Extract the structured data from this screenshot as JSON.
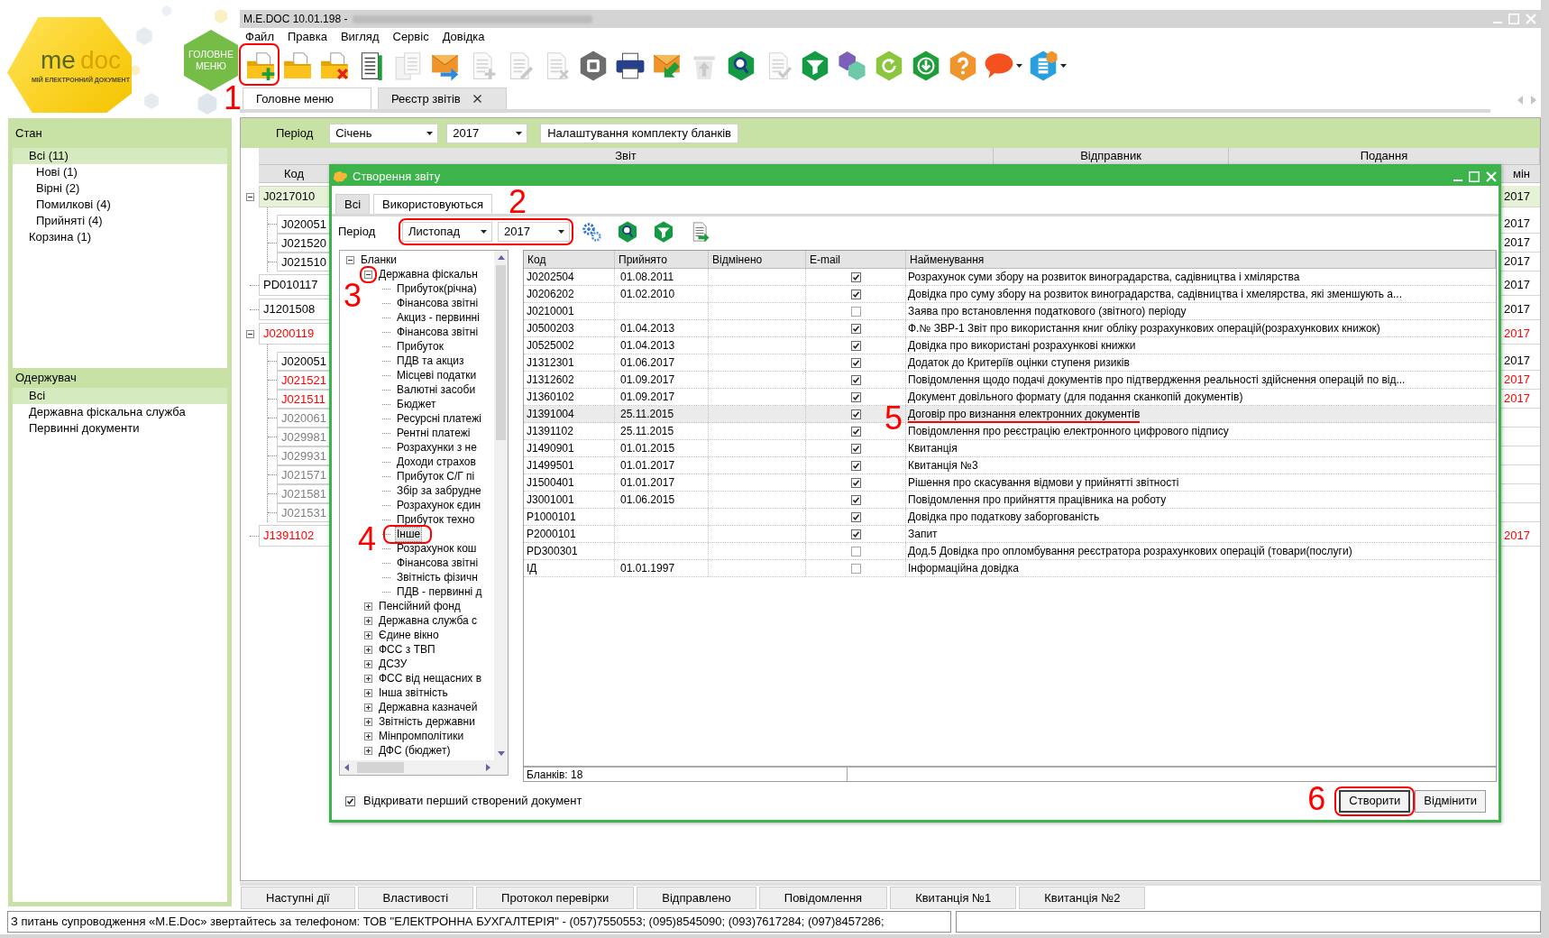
{
  "logo": {
    "brand_left": "me",
    "brand_right": "doc",
    "tagline": "МІЙ ЕЛЕКТРОННИЙ ДОКУМЕНТ"
  },
  "home_button": {
    "label": "ГОЛОВНЕ МЕНЮ"
  },
  "window": {
    "title": "M.E.DOC 10.01.198 -"
  },
  "menu": [
    "Файл",
    "Правка",
    "Вигляд",
    "Сервіс",
    "Довідка"
  ],
  "toolbar": [
    {
      "kind": "new-folder",
      "disabled": false,
      "annotation": "1"
    },
    {
      "kind": "open-folder",
      "disabled": false
    },
    {
      "kind": "delete-folder",
      "disabled": false
    },
    {
      "kind": "document-list",
      "disabled": false
    },
    {
      "kind": "copy-document",
      "disabled": true
    },
    {
      "kind": "send-envelope",
      "disabled": false
    },
    {
      "kind": "add-document",
      "disabled": true
    },
    {
      "kind": "edit-document",
      "disabled": true
    },
    {
      "kind": "remove-document",
      "disabled": true
    },
    {
      "kind": "archive",
      "disabled": false
    },
    {
      "kind": "printer",
      "disabled": false
    },
    {
      "kind": "receive-envelope",
      "disabled": false
    },
    {
      "kind": "upload-bin",
      "disabled": true
    },
    {
      "kind": "search",
      "disabled": false
    },
    {
      "kind": "check-document",
      "disabled": true
    },
    {
      "kind": "filter",
      "disabled": false
    },
    {
      "kind": "hexagons",
      "disabled": false
    },
    {
      "kind": "refresh",
      "disabled": false
    },
    {
      "kind": "download",
      "disabled": false
    },
    {
      "kind": "help",
      "disabled": false
    },
    {
      "kind": "chat",
      "disabled": false,
      "menu": true
    },
    {
      "kind": "video-help",
      "disabled": false,
      "menu": true
    }
  ],
  "tabs": [
    {
      "label": "Головне меню",
      "selected": false,
      "closable": false
    },
    {
      "label": "Реєстр звітів",
      "selected": true,
      "closable": true
    }
  ],
  "status_panel": {
    "title": "Стан",
    "items": [
      {
        "label": "Всі (11)",
        "selected": true,
        "children": [
          {
            "label": "Нові (1)",
            "selected": false
          },
          {
            "label": "Вірні (2)",
            "selected": false
          },
          {
            "label": "Помилкові (4)",
            "selected": false
          },
          {
            "label": "Прийняті (4)",
            "selected": false
          }
        ]
      },
      {
        "label": "Корзина (1)",
        "selected": false
      }
    ]
  },
  "recipient_panel": {
    "title": "Одержувач",
    "items": [
      {
        "label": "Всі",
        "selected": true
      },
      {
        "label": "Державна фіскальна служба",
        "selected": false
      },
      {
        "label": "Первинні документи",
        "selected": false
      }
    ]
  },
  "filter_bar": {
    "period_label": "Період",
    "month": "Січень",
    "year": "2017",
    "settings_button": "Налаштування комплекту бланків"
  },
  "register": {
    "group_headers": [
      "Звіт",
      "Відправник",
      "Подання"
    ],
    "columns": [
      "Код",
      "мін"
    ],
    "rows": [
      {
        "code": "J0217010",
        "color": "#000000",
        "selected": true,
        "expanded": true,
        "year": "2017",
        "children": [
          {
            "code": "J020051",
            "color": "#000000",
            "selected": false,
            "year": "2017"
          },
          {
            "code": "J021520",
            "color": "#000000",
            "selected": false,
            "year": "2017"
          },
          {
            "code": "J021510",
            "color": "#000000",
            "selected": false,
            "year": "2017"
          }
        ]
      },
      {
        "code": "PD010117",
        "color": "#000000",
        "selected": false,
        "year": "2017"
      },
      {
        "code": "J1201508",
        "color": "#000000",
        "selected": false,
        "year": "2017"
      },
      {
        "code": "J0200119",
        "color": "#ff0000",
        "selected": false,
        "expanded": true,
        "year": "2017",
        "children": [
          {
            "code": "J020051",
            "color": "#000000",
            "selected": false,
            "year": "2017"
          },
          {
            "code": "J021521",
            "color": "#ff0000",
            "selected": false,
            "year": "2017"
          },
          {
            "code": "J021511",
            "color": "#ff0000",
            "selected": false,
            "year": "2017"
          },
          {
            "code": "J020061",
            "color": "#808080",
            "selected": false
          },
          {
            "code": "J029981",
            "color": "#808080",
            "selected": false
          },
          {
            "code": "J029931",
            "color": "#808080",
            "selected": false
          },
          {
            "code": "J021571",
            "color": "#808080",
            "selected": false
          },
          {
            "code": "J021581",
            "color": "#808080",
            "selected": false
          },
          {
            "code": "J021531",
            "color": "#808080",
            "selected": false
          }
        ]
      },
      {
        "code": "J1391102",
        "color": "#ff0000",
        "selected": false,
        "year": "2017"
      }
    ]
  },
  "dialog": {
    "title": "Створення звіту",
    "tabs": [
      {
        "label": "Всі",
        "selected": true
      },
      {
        "label": "Використовуються",
        "selected": false
      }
    ],
    "period_label": "Період",
    "month": "Листопад",
    "year": "2017",
    "period_annotation": "2",
    "toolbar": [
      {
        "kind": "settings"
      },
      {
        "kind": "search"
      },
      {
        "kind": "filter"
      },
      {
        "kind": "export-document"
      }
    ],
    "tree": [
      {
        "label": "Бланки",
        "expanded": true,
        "selected": false,
        "children": [
          {
            "label": "Державна фіскальн",
            "expanded": true,
            "selected": false,
            "annotation": "3",
            "children": [
              {
                "label": "Прибуток(річна)",
                "selected": false
              },
              {
                "label": "Фінансова звітні",
                "selected": false
              },
              {
                "label": "Акциз - первинні",
                "selected": false
              },
              {
                "label": "Фінансова звітні",
                "selected": false
              },
              {
                "label": "Прибуток",
                "selected": false
              },
              {
                "label": "ПДВ та акциз",
                "selected": false
              },
              {
                "label": "Місцеві податки",
                "selected": false
              },
              {
                "label": "Валютні засоби",
                "selected": false
              },
              {
                "label": "Бюджет",
                "selected": false
              },
              {
                "label": "Ресурсні платежі",
                "selected": false
              },
              {
                "label": "Рентні платежі",
                "selected": false
              },
              {
                "label": "Розрахунки з не",
                "selected": false
              },
              {
                "label": "Доходи страхов",
                "selected": false
              },
              {
                "label": "Прибуток С/Г пі",
                "selected": false
              },
              {
                "label": "Збір за забрудне",
                "selected": false
              },
              {
                "label": "Розрахунок єдин",
                "selected": false
              },
              {
                "label": "Прибуток техно",
                "selected": false
              },
              {
                "label": "Інше",
                "selected": true,
                "annotation": "4"
              },
              {
                "label": "Розрахунок кош",
                "selected": false
              },
              {
                "label": "Фінансова звітні",
                "selected": false
              },
              {
                "label": "Звітність фізичн",
                "selected": false
              },
              {
                "label": "ПДВ - первинні д",
                "selected": false
              }
            ]
          },
          {
            "label": "Пенсійний фонд",
            "expanded": false,
            "selected": false
          },
          {
            "label": "Державна служба с",
            "expanded": false,
            "selected": false
          },
          {
            "label": "Єдине вікно",
            "expanded": false,
            "selected": false
          },
          {
            "label": "ФСС з ТВП",
            "expanded": false,
            "selected": false
          },
          {
            "label": "ДСЗУ",
            "expanded": false,
            "selected": false
          },
          {
            "label": "ФСС від нещасних в",
            "expanded": false,
            "selected": false
          },
          {
            "label": "Інша звітність",
            "expanded": false,
            "selected": false
          },
          {
            "label": "Державна казначей",
            "expanded": false,
            "selected": false
          },
          {
            "label": "Звітність державни",
            "expanded": false,
            "selected": false
          },
          {
            "label": "Мінпромполітики",
            "expanded": false,
            "selected": false
          },
          {
            "label": "ДФС (бюджет)",
            "expanded": false,
            "selected": false
          }
        ]
      }
    ],
    "table": {
      "columns": [
        "Код",
        "Прийнято",
        "Відмінено",
        "E-mail",
        "Найменування"
      ],
      "rows": [
        {
          "code": "J0202504",
          "accepted": "01.08.2011",
          "email": true,
          "selected": false,
          "name": "Розрахунок суми збору на розвиток виноградарства, садівництва і хмілярства"
        },
        {
          "code": "J0206202",
          "accepted": "01.02.2010",
          "email": true,
          "selected": false,
          "name": "Довідка про суму збору на розвиток виноградарства, садівництва і хмелярства, які зменшують а..."
        },
        {
          "code": "J0210001",
          "email": false,
          "selected": false,
          "name": "Заява про встановлення податкового (звітного) періоду"
        },
        {
          "code": "J0500203",
          "accepted": "01.04.2013",
          "email": true,
          "selected": false,
          "name": "Ф.№ ЗВР-1 Звіт про використання книг обліку розрахункових операцій(розрахункових книжок)"
        },
        {
          "code": "J0525002",
          "accepted": "01.04.2013",
          "email": true,
          "selected": false,
          "name": "Довідка про використані розрахункові книжки"
        },
        {
          "code": "J1312301",
          "accepted": "01.06.2017",
          "email": true,
          "selected": false,
          "name": "Додаток до Критеріїв оцінки ступеня ризиків"
        },
        {
          "code": "J1312602",
          "accepted": "01.09.2017",
          "email": true,
          "selected": false,
          "name": "Повідомлення щодо подачі документів про підтвердження реальності здійснення операцій по від..."
        },
        {
          "code": "J1360102",
          "accepted": "01.09.2017",
          "email": true,
          "selected": false,
          "name": "Документ довільного формату (для подання сканкопій документів)"
        },
        {
          "code": "J1391004",
          "accepted": "25.11.2015",
          "email": true,
          "selected": true,
          "annotation": "5",
          "name": "Договір про визнання електронних документів"
        },
        {
          "code": "J1391102",
          "accepted": "25.11.2015",
          "email": true,
          "selected": false,
          "name": "Повідомлення про реєстрацію електронного цифрового підпису"
        },
        {
          "code": "J1490901",
          "accepted": "01.01.2015",
          "email": true,
          "selected": false,
          "name": "Квитанція"
        },
        {
          "code": "J1499501",
          "accepted": "01.01.2017",
          "email": true,
          "selected": false,
          "name": "Квитанція №3"
        },
        {
          "code": "J1500401",
          "accepted": "01.01.2017",
          "email": true,
          "selected": false,
          "name": "Рішення про скасування відмови у прийнятті звітності"
        },
        {
          "code": "J3001001",
          "accepted": "01.06.2015",
          "email": true,
          "selected": false,
          "name": "Повідомлення про прийняття працівника на роботу"
        },
        {
          "code": "P1000101",
          "email": true,
          "selected": false,
          "name": "Довідка про податкову заборгованість"
        },
        {
          "code": "P2000101",
          "email": true,
          "selected": false,
          "name": "Запит"
        },
        {
          "code": "PD300301",
          "email": false,
          "selected": false,
          "name": "Дод.5 Довідка про опломбування реєстратора розрахункових операцій (товари(послуги)"
        },
        {
          "code": "ІД",
          "accepted": "01.01.1997",
          "email": false,
          "selected": false,
          "name": "Інформаційна довідка"
        }
      ],
      "footer": "Бланків: 18"
    },
    "open_first": {
      "label": "Відкривати перший створений документ",
      "checked": true
    },
    "buttons": [
      {
        "label": "Створити",
        "default": true,
        "annotation": "6"
      },
      {
        "label": "Відмінити",
        "default": false
      }
    ]
  },
  "bottom_tabs": [
    {
      "label": "Наступні дії",
      "selected": false
    },
    {
      "label": "Властивості",
      "selected": false
    },
    {
      "label": "Протокол перевірки",
      "selected": false
    },
    {
      "label": "Відправлено",
      "selected": false
    },
    {
      "label": "Повідомлення",
      "selected": false
    },
    {
      "label": "Квитанція №1",
      "selected": false
    },
    {
      "label": "Квитанція №2",
      "selected": false
    }
  ],
  "status_bar": {
    "message": "З питань супроводження «M.E.Doc» звертайтесь за телефоном: ТОВ \"ЕЛЕКТРОННА БУХГАЛТЕРІЯ\" - (057)7550553; (095)8545090; (093)7617284; (097)8457286;"
  }
}
